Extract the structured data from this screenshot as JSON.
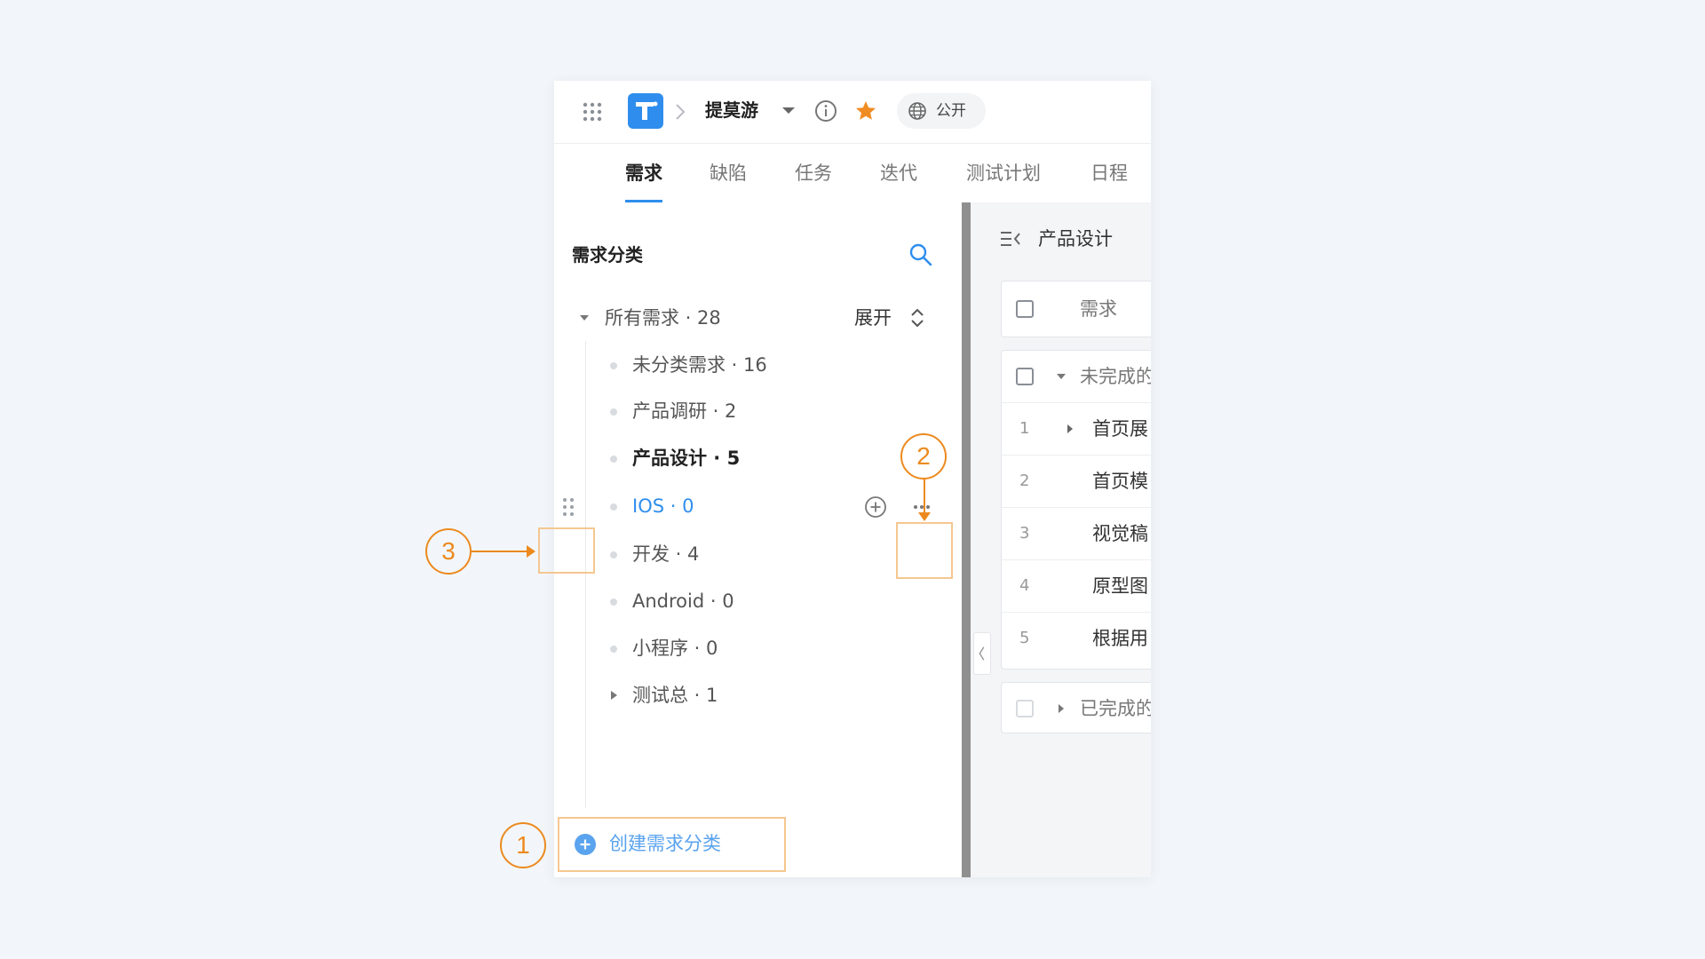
{
  "header": {
    "project_name": "提莫游",
    "public_label": "公开"
  },
  "tabs": [
    {
      "label": "需求",
      "active": true
    },
    {
      "label": "缺陷"
    },
    {
      "label": "任务"
    },
    {
      "label": "迭代"
    },
    {
      "label": "测试计划"
    },
    {
      "label": "日程"
    }
  ],
  "sidebar": {
    "title": "需求分类",
    "all_label": "所有需求 · 28",
    "expand_label": "展开",
    "items": [
      {
        "label": "未分类需求 · 16"
      },
      {
        "label": "产品调研 · 2"
      },
      {
        "label": "产品设计 · 5"
      },
      {
        "label": "IOS · 0"
      },
      {
        "label": "开发 · 4"
      },
      {
        "label": "Android · 0"
      },
      {
        "label": "小程序 · 0"
      },
      {
        "label": "测试总 · 1"
      }
    ],
    "create_label": "创建需求分类"
  },
  "main": {
    "title": "产品设计",
    "column_header": "需求",
    "group_incomplete": "未完成的",
    "group_complete": "已完成的",
    "rows": [
      {
        "num": "1",
        "text": "首页展"
      },
      {
        "num": "2",
        "text": "首页模"
      },
      {
        "num": "3",
        "text": "视觉稿"
      },
      {
        "num": "4",
        "text": "原型图"
      },
      {
        "num": "5",
        "text": "根据用"
      }
    ]
  },
  "annotations": [
    "1",
    "2",
    "3"
  ],
  "colors": {
    "accent": "#2f8eed",
    "annotation": "#ec8a1f",
    "star": "#f08c24",
    "background": "#f2f6fa"
  },
  "icons": [
    "app-grid-icon",
    "app-logo-icon",
    "breadcrumb-chevron-icon",
    "caret-down-icon",
    "info-icon",
    "star-icon",
    "globe-icon",
    "search-icon",
    "expand-collapse-icon",
    "drag-handle-icon",
    "add-circle-icon",
    "more-icon",
    "plus-circle-icon",
    "menu-fold-icon",
    "collapse-left-icon"
  ]
}
